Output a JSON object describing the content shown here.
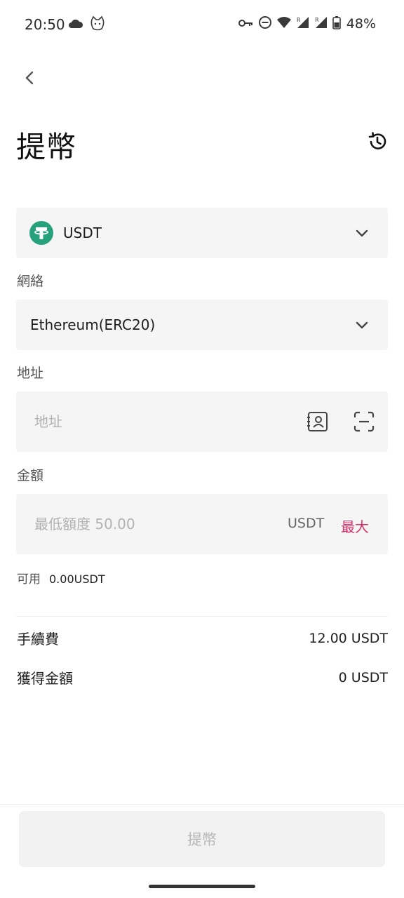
{
  "status_bar": {
    "time": "20:50",
    "battery": "48%",
    "icons": [
      "cloud-icon",
      "cat-icon",
      "key-icon",
      "do-not-disturb-icon",
      "wifi-icon",
      "signal-r-icon",
      "signal-r-icon",
      "battery-icon"
    ]
  },
  "header": {
    "title": "提幣"
  },
  "coin": {
    "name": "USDT",
    "logo_color": "#26a17b"
  },
  "network": {
    "label": "網絡",
    "value": "Ethereum(ERC20)"
  },
  "address": {
    "label": "地址",
    "placeholder": "地址"
  },
  "amount": {
    "label": "金額",
    "placeholder": "最低額度 50.00",
    "unit": "USDT",
    "max_label": "最大"
  },
  "available": {
    "label": "可用",
    "value": "0.00USDT"
  },
  "summary": {
    "fee_label": "手續費",
    "fee_value": "12.00 USDT",
    "receive_label": "獲得金額",
    "receive_value": "0 USDT"
  },
  "submit": {
    "label": "提幣"
  },
  "colors": {
    "accent": "#d6326b",
    "field_bg": "#f5f5f5"
  }
}
